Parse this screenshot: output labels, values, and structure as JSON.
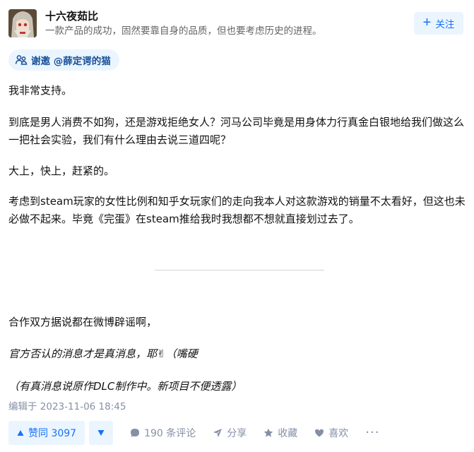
{
  "author": {
    "name": "十六夜茹比",
    "bio": "一款产品的成功，固然要靠自身的品质，但也要考虑历史的进程。",
    "follow_label": "关注"
  },
  "invite": {
    "label": "谢邀 @薛定谔的猫"
  },
  "content": {
    "p1": "我非常支持。",
    "p2": "到底是男人消费不如狗，还是游戏拒绝女人？河马公司毕竟是用身体力行真金白银地给我们做这么一把社会实验，我们有什么理由去说三道四呢？",
    "p3": "大上，快上，赶紧的。",
    "p4": "考虑到steam玩家的女性比例和知乎女玩家们的走向我本人对这款游戏的销量不太看好，但这也未必做不起来。毕竟《完蛋》在steam推给我时我想都不想就直接划过去了。",
    "p5": "合作双方据说都在微博辟谣啊，",
    "p6_text": "官方否认的消息才是真消息，耶",
    "p6_emoji": "✌",
    "p6_tail": "（嘴硬",
    "p7": "（有真消息说原作DLC制作中。新项目不便透露）"
  },
  "meta": {
    "edited": "编辑于 2023-11-06 18:45"
  },
  "actions": {
    "vote_up": "赞同 3097",
    "comments": "190 条评论",
    "share": "分享",
    "collect": "收藏",
    "like": "喜欢",
    "more": "···"
  },
  "colors": {
    "accent": "#1772f6",
    "accent_bg": "#ebf5ff",
    "muted": "#8590a6"
  }
}
